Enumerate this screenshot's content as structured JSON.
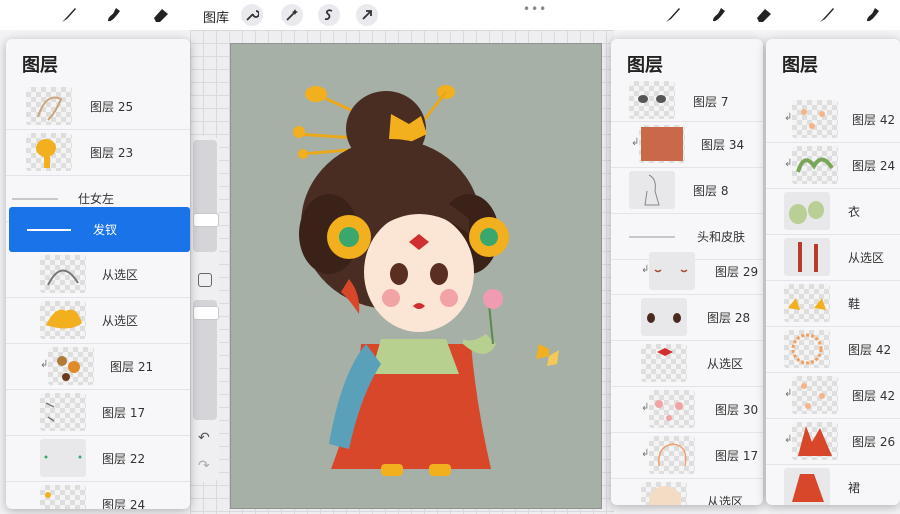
{
  "toolbar": {
    "gallery_label": "图库",
    "tools_left": [
      "brush-icon",
      "smudge-icon",
      "eraser-icon"
    ],
    "tools_mid": [
      "wrench-icon",
      "magic-wand-icon",
      "selection-icon",
      "transform-arrow-icon"
    ],
    "tools_right": [
      "brush-icon",
      "smudge-icon",
      "eraser-icon",
      "brush-icon",
      "smudge-icon"
    ]
  },
  "panels": [
    {
      "title": "图层",
      "rows": [
        {
          "label": "图层 25"
        },
        {
          "label": "图层 23"
        },
        {
          "label": "仕女左"
        },
        {
          "label": "发钗"
        },
        {
          "label": "从选区"
        },
        {
          "label": "从选区"
        },
        {
          "label": "图层 21"
        },
        {
          "label": "图层 17"
        },
        {
          "label": "图层 22"
        },
        {
          "label": "图层 24"
        }
      ]
    },
    {
      "title": "图层",
      "rows": [
        {
          "label": "图层 7"
        },
        {
          "label": "图层 34"
        },
        {
          "label": "图层 8"
        },
        {
          "label": "头和皮肤"
        },
        {
          "label": "图层 29"
        },
        {
          "label": "图层 28"
        },
        {
          "label": "从选区"
        },
        {
          "label": "图层 30"
        },
        {
          "label": "图层 17"
        },
        {
          "label": "从选区"
        }
      ]
    },
    {
      "title": "图层",
      "rows": [
        {
          "label": "图层 42"
        },
        {
          "label": "图层 24"
        },
        {
          "label": "衣"
        },
        {
          "label": "从选区"
        },
        {
          "label": "鞋"
        },
        {
          "label": "图层 42"
        },
        {
          "label": "图层 42"
        },
        {
          "label": "图层 26"
        },
        {
          "label": "裙"
        }
      ]
    }
  ],
  "colors": {
    "accent": "#1a73e8",
    "artboard": "#a6b0a6",
    "hair": "#4a2d22",
    "robe": "#d9472b",
    "gold": "#f2b01e"
  }
}
